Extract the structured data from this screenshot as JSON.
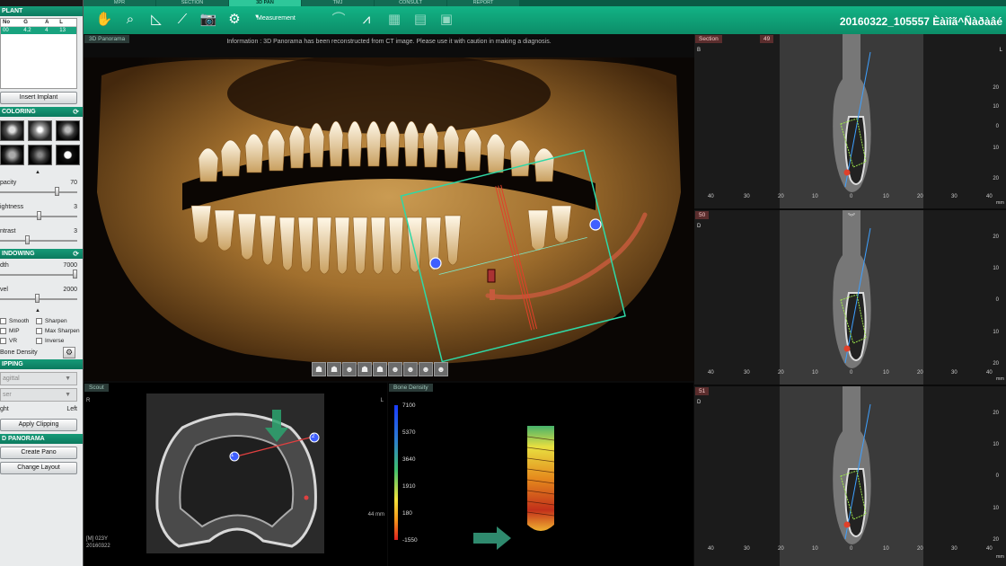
{
  "app": {
    "brand": "",
    "case_id": "20160322_105557 Èàìîã^Ñàðàâé",
    "tabs": [
      "MPR",
      "SECTION",
      "3D PAN",
      "TMJ",
      "CONSULT",
      "REPORT"
    ],
    "active_tab": "3D PAN",
    "measurement_label": "Measurement"
  },
  "toolbar": {
    "tools": [
      "hand-icon",
      "zoom-icon",
      "angle-icon",
      "curve-icon",
      "camera-icon",
      "capture-settings-icon",
      "measurement-icon",
      "nerve-icon",
      "panoramic-curve-icon",
      "image-icon",
      "layout-icon",
      "export-icon"
    ]
  },
  "sidebar": {
    "implant": {
      "header": "PLANT",
      "columns": [
        "No",
        "G",
        "A",
        "L"
      ],
      "rows": [
        [
          "00",
          "4.2",
          "4",
          "13"
        ]
      ],
      "insert_button": "Insert Implant"
    },
    "coloring": {
      "header": "COLORING",
      "sliders": [
        {
          "label": "pacity",
          "value": "70",
          "level": 0.75
        },
        {
          "label": "ightness",
          "value": "3",
          "level": 0.5
        },
        {
          "label": "ntrast",
          "value": "3",
          "level": 0.35
        }
      ]
    },
    "windowing": {
      "header": "INDOWING",
      "sliders": [
        {
          "label": "dth",
          "value": "7000",
          "level": 1.0
        },
        {
          "label": "vel",
          "value": "2000",
          "level": 0.48
        }
      ],
      "checks": [
        "Smooth",
        "Sharpen",
        "MIP",
        "Max Sharpen",
        "VR",
        "Inverse"
      ],
      "bone_density": "Bone Density"
    },
    "clipping": {
      "header": "IPPING",
      "dd1": "agittal",
      "dd2": "ser",
      "left_label": "ght",
      "right_label": "Left",
      "apply_button": "Apply Clipping"
    },
    "panorama": {
      "header": "D PANORAMA",
      "create_button": "Create Pano",
      "layout_button": "Change Layout"
    }
  },
  "pano": {
    "tag": "3D Panorama",
    "info": "Information : 3D Panorama has been reconstructed from CT image. Please use it with caution in making a diagnosis."
  },
  "scout": {
    "tag": "Scout",
    "right_marker": "R",
    "left_marker": "L",
    "meta_line1": "[M] 023Y",
    "meta_line2": "20160322",
    "mm": "44 mm",
    "markers": [
      "1",
      "2"
    ]
  },
  "bone_density": {
    "tag": "Bone Density",
    "scale": [
      "7100",
      "5370",
      "3640",
      "1910",
      "180",
      "-1550"
    ]
  },
  "sections": [
    {
      "num": "Section",
      "num2": "49",
      "side": "B",
      "right": "L"
    },
    {
      "num": "50",
      "num2": "",
      "side": "D",
      "right": ""
    },
    {
      "num": "51",
      "num2": "",
      "side": "D",
      "right": ""
    }
  ],
  "section_axis": {
    "x": [
      "40",
      "30",
      "20",
      "10",
      "0",
      "10",
      "20",
      "30",
      "40"
    ],
    "y": [
      "20",
      "10",
      "0",
      "10",
      "20"
    ],
    "unit": "mm"
  },
  "colors": {
    "accent": "#12b385",
    "implant_row": "#19a37f",
    "canal": "#c65a3c",
    "frame": "#2fd8a6",
    "section_tag": "#5a2d2d"
  }
}
